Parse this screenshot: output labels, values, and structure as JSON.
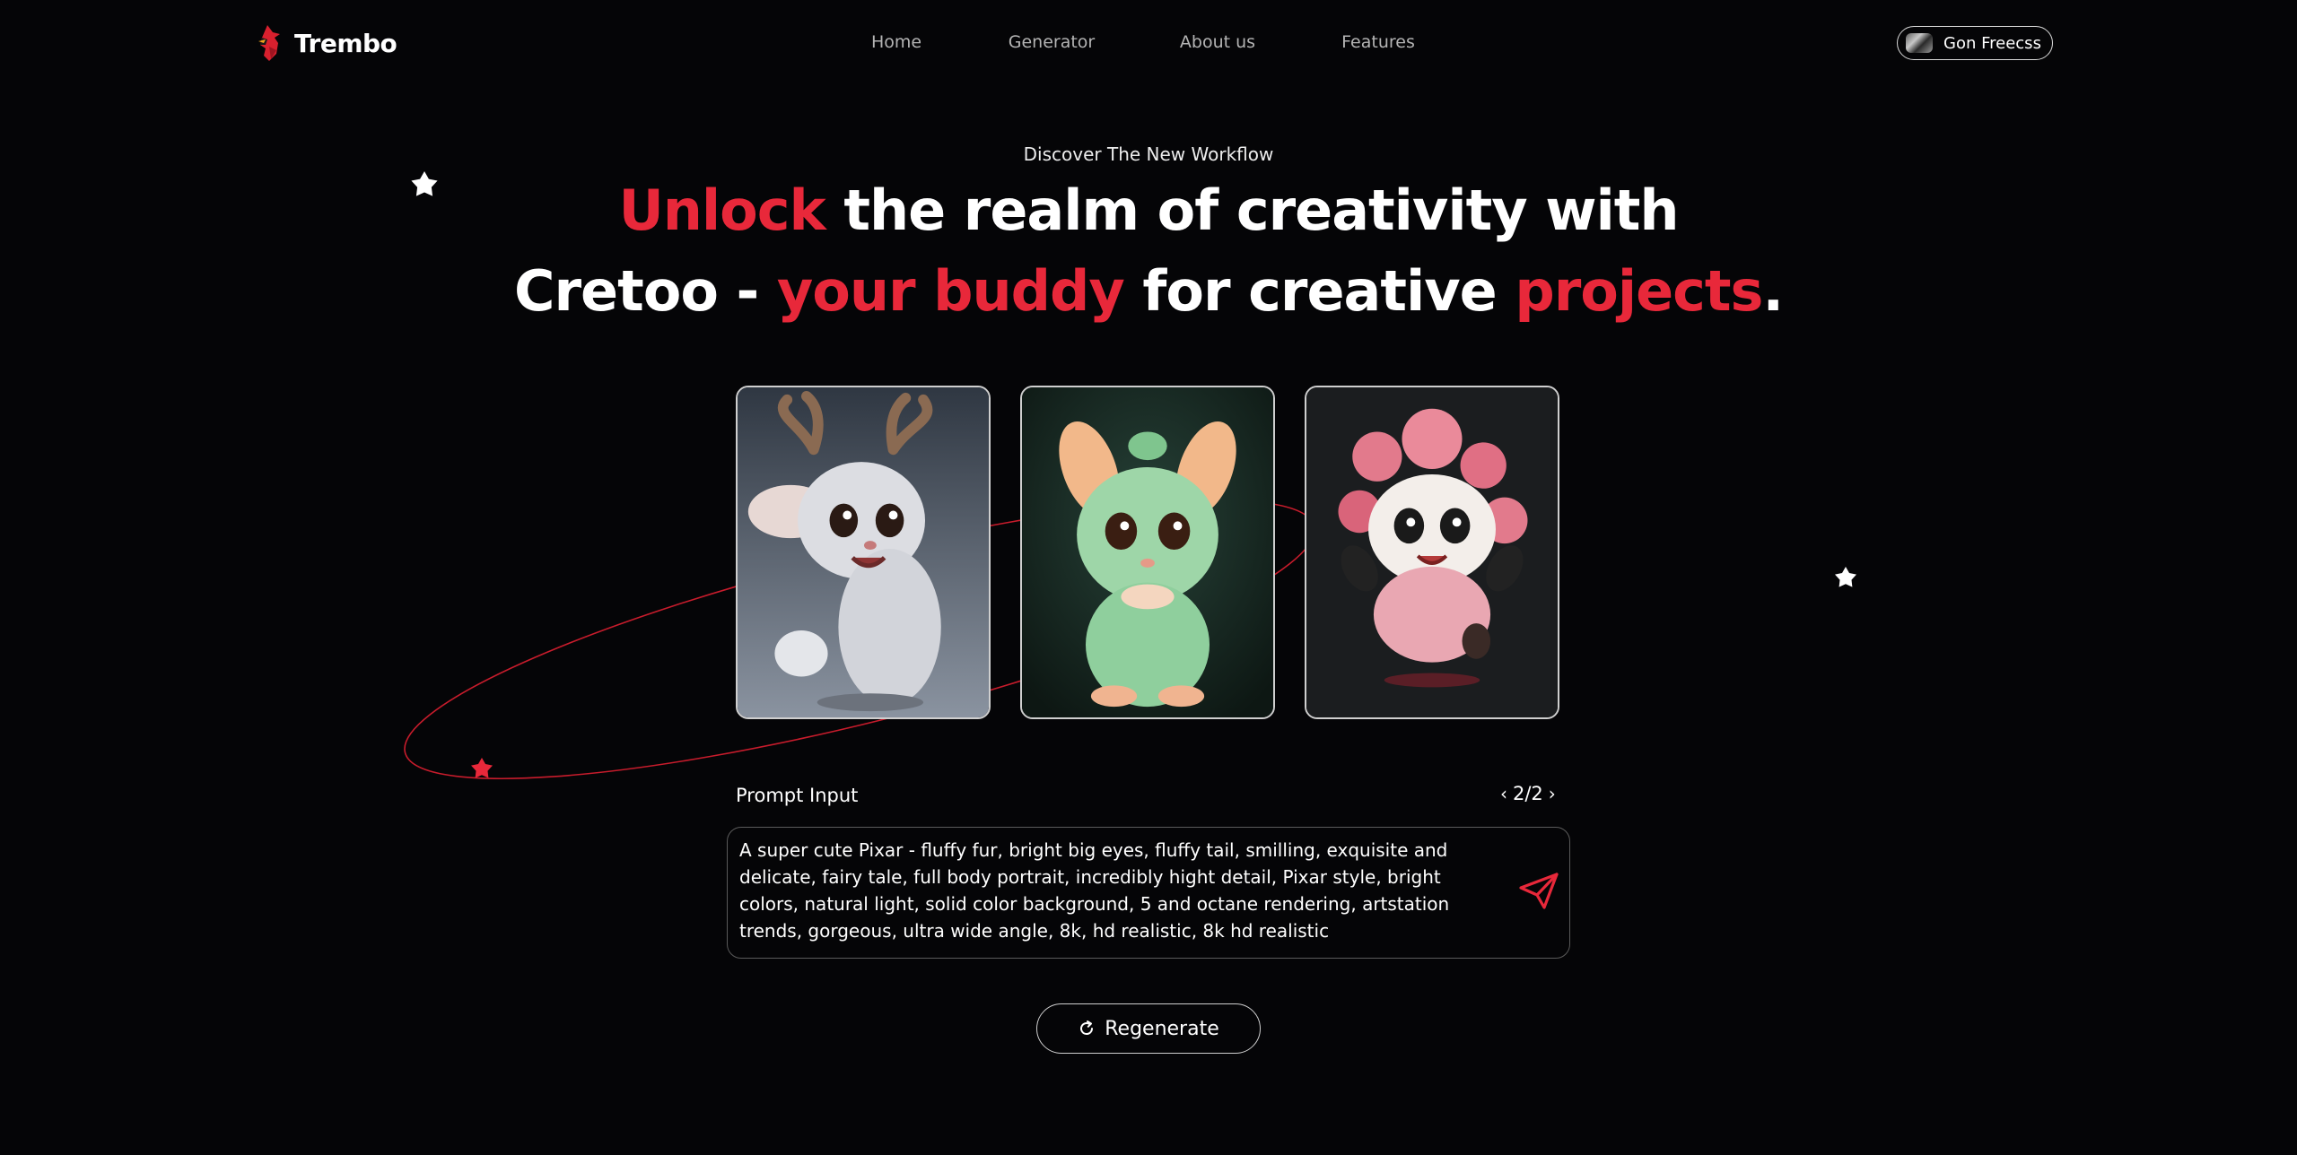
{
  "brand": {
    "name": "Trembo",
    "accent": "#e8283a"
  },
  "nav": {
    "items": [
      "Home",
      "Generator",
      "About us",
      "Features"
    ]
  },
  "user": {
    "name": "Gon Freecss"
  },
  "hero": {
    "eyebrow": "Discover The New Workflow",
    "headline_line1": [
      {
        "text": "Unlock",
        "accent": true
      },
      {
        "text": " the realm of creativity with",
        "accent": false
      }
    ],
    "headline_line2": [
      {
        "text": "Cretoo - ",
        "accent": false
      },
      {
        "text": "your buddy",
        "accent": true
      },
      {
        "text": " for creative ",
        "accent": false
      },
      {
        "text": "projects",
        "accent": true
      },
      {
        "text": ".",
        "accent": false
      }
    ]
  },
  "gallery": {
    "images": [
      {
        "subject": "deer-bunny",
        "icon": "deer-image"
      },
      {
        "subject": "green-creature",
        "icon": "creature-image"
      },
      {
        "subject": "panda",
        "icon": "panda-image"
      }
    ]
  },
  "prompt": {
    "label": "Prompt Input",
    "pager": "2/2",
    "prev_icon": "chevron-left-icon",
    "next_icon": "chevron-right-icon",
    "text": "A super cute Pixar - fluffy fur, bright big eyes, fluffy tail, smilling, exquisite and delicate, fairy tale, full body portrait, incredibly hight detail, Pixar style, bright colors, natural light, solid color background, 5 and octane rendering, artstation trends, gorgeous, ultra wide angle, 8k, hd realistic, 8k hd realistic",
    "send_icon": "send-icon"
  },
  "actions": {
    "regenerate_label": "Regenerate",
    "regenerate_icon": "refresh-icon"
  }
}
